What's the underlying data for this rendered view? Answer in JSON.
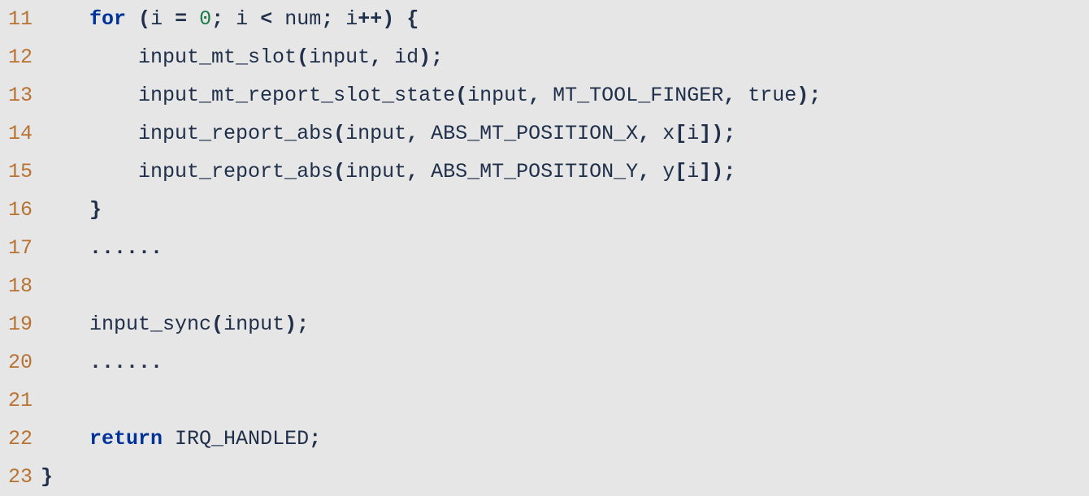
{
  "lines": [
    {
      "n": 11,
      "segs": [
        {
          "cls": "txt",
          "t": "    "
        },
        {
          "cls": "kw",
          "t": "for"
        },
        {
          "cls": "txt",
          "t": " "
        },
        {
          "cls": "pun",
          "t": "("
        },
        {
          "cls": "id",
          "t": "i"
        },
        {
          "cls": "txt",
          "t": " "
        },
        {
          "cls": "pun",
          "t": "="
        },
        {
          "cls": "txt",
          "t": " "
        },
        {
          "cls": "num",
          "t": "0"
        },
        {
          "cls": "pun",
          "t": ";"
        },
        {
          "cls": "txt",
          "t": " "
        },
        {
          "cls": "id",
          "t": "i"
        },
        {
          "cls": "txt",
          "t": " "
        },
        {
          "cls": "pun",
          "t": "<"
        },
        {
          "cls": "txt",
          "t": " "
        },
        {
          "cls": "id",
          "t": "num"
        },
        {
          "cls": "pun",
          "t": ";"
        },
        {
          "cls": "txt",
          "t": " "
        },
        {
          "cls": "id",
          "t": "i"
        },
        {
          "cls": "pun",
          "t": "++)"
        },
        {
          "cls": "txt",
          "t": " "
        },
        {
          "cls": "pun",
          "t": "{"
        }
      ]
    },
    {
      "n": 12,
      "segs": [
        {
          "cls": "txt",
          "t": "        "
        },
        {
          "cls": "id",
          "t": "input_mt_slot"
        },
        {
          "cls": "pun",
          "t": "("
        },
        {
          "cls": "id",
          "t": "input"
        },
        {
          "cls": "pun",
          "t": ","
        },
        {
          "cls": "txt",
          "t": " "
        },
        {
          "cls": "id",
          "t": "id"
        },
        {
          "cls": "pun",
          "t": ");"
        }
      ]
    },
    {
      "n": 13,
      "segs": [
        {
          "cls": "txt",
          "t": "        "
        },
        {
          "cls": "id",
          "t": "input_mt_report_slot_state"
        },
        {
          "cls": "pun",
          "t": "("
        },
        {
          "cls": "id",
          "t": "input"
        },
        {
          "cls": "pun",
          "t": ","
        },
        {
          "cls": "txt",
          "t": " "
        },
        {
          "cls": "id",
          "t": "MT_TOOL_FINGER"
        },
        {
          "cls": "pun",
          "t": ","
        },
        {
          "cls": "txt",
          "t": " "
        },
        {
          "cls": "id",
          "t": "true"
        },
        {
          "cls": "pun",
          "t": ");"
        }
      ]
    },
    {
      "n": 14,
      "segs": [
        {
          "cls": "txt",
          "t": "        "
        },
        {
          "cls": "id",
          "t": "input_report_abs"
        },
        {
          "cls": "pun",
          "t": "("
        },
        {
          "cls": "id",
          "t": "input"
        },
        {
          "cls": "pun",
          "t": ","
        },
        {
          "cls": "txt",
          "t": " "
        },
        {
          "cls": "id",
          "t": "ABS_MT_POSITION_X"
        },
        {
          "cls": "pun",
          "t": ","
        },
        {
          "cls": "txt",
          "t": " "
        },
        {
          "cls": "id",
          "t": "x"
        },
        {
          "cls": "pun",
          "t": "["
        },
        {
          "cls": "id",
          "t": "i"
        },
        {
          "cls": "pun",
          "t": "]);"
        }
      ]
    },
    {
      "n": 15,
      "segs": [
        {
          "cls": "txt",
          "t": "        "
        },
        {
          "cls": "id",
          "t": "input_report_abs"
        },
        {
          "cls": "pun",
          "t": "("
        },
        {
          "cls": "id",
          "t": "input"
        },
        {
          "cls": "pun",
          "t": ","
        },
        {
          "cls": "txt",
          "t": " "
        },
        {
          "cls": "id",
          "t": "ABS_MT_POSITION_Y"
        },
        {
          "cls": "pun",
          "t": ","
        },
        {
          "cls": "txt",
          "t": " "
        },
        {
          "cls": "id",
          "t": "y"
        },
        {
          "cls": "pun",
          "t": "["
        },
        {
          "cls": "id",
          "t": "i"
        },
        {
          "cls": "pun",
          "t": "]);"
        }
      ]
    },
    {
      "n": 16,
      "segs": [
        {
          "cls": "txt",
          "t": "    "
        },
        {
          "cls": "pun",
          "t": "}"
        }
      ]
    },
    {
      "n": 17,
      "segs": [
        {
          "cls": "txt",
          "t": "    "
        },
        {
          "cls": "pun",
          "t": "......"
        }
      ]
    },
    {
      "n": 18,
      "segs": []
    },
    {
      "n": 19,
      "segs": [
        {
          "cls": "txt",
          "t": "    "
        },
        {
          "cls": "id",
          "t": "input_sync"
        },
        {
          "cls": "pun",
          "t": "("
        },
        {
          "cls": "id",
          "t": "input"
        },
        {
          "cls": "pun",
          "t": ");"
        }
      ]
    },
    {
      "n": 20,
      "segs": [
        {
          "cls": "txt",
          "t": "    "
        },
        {
          "cls": "pun",
          "t": "......"
        }
      ]
    },
    {
      "n": 21,
      "segs": []
    },
    {
      "n": 22,
      "segs": [
        {
          "cls": "txt",
          "t": "    "
        },
        {
          "cls": "kw",
          "t": "return"
        },
        {
          "cls": "txt",
          "t": " "
        },
        {
          "cls": "id",
          "t": "IRQ_HANDLED"
        },
        {
          "cls": "pun",
          "t": ";"
        }
      ]
    },
    {
      "n": 23,
      "segs": [
        {
          "cls": "pun",
          "t": "}"
        }
      ]
    }
  ]
}
